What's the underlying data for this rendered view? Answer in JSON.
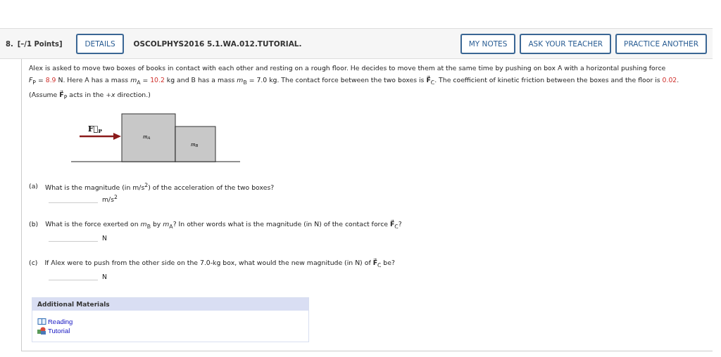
{
  "question": {
    "number": "8.",
    "points": "[–/1 Points]",
    "details_button": "DETAILS",
    "code": "OSCOLPHYS2016 5.1.WA.012.TUTORIAL.",
    "actions": [
      "MY NOTES",
      "ASK YOUR TEACHER",
      "PRACTICE ANOTHER"
    ]
  },
  "problem": {
    "lines": [
      [
        {
          "kind": "text",
          "text": "Alex is asked to move two boxes of books in contact with each other and resting on a rough floor. He decides to move them at the same time by pushing on box A with a horizontal pushing force"
        }
      ],
      [
        {
          "kind": "text",
          "text": "*F*$_{P}$ = "
        },
        {
          "kind": "value",
          "text": "8.9"
        },
        {
          "kind": "text",
          "text": " N. Here A has a mass *m*$_{A}$ = "
        },
        {
          "kind": "value",
          "text": "10.2"
        },
        {
          "kind": "text",
          "text": " kg and B has a mass *m*$_{B}$ = 7.0 kg. The contact force between the two boxes is **F⃗**$_{C}$. The coefficient of kinetic friction between the boxes and the floor is "
        },
        {
          "kind": "value",
          "text": "0.02"
        },
        {
          "kind": "text",
          "text": "."
        }
      ],
      [
        {
          "kind": "text",
          "text": "(Assume **F⃗**$_{P}$ acts in the +*x* direction.)"
        }
      ]
    ]
  },
  "diagram": {
    "force_label": {
      "symbol": "F⃗",
      "subscript": "P"
    },
    "box_a": {
      "symbol": "m",
      "subscript": "A"
    },
    "box_b": {
      "symbol": "m",
      "subscript": "B"
    }
  },
  "parts": [
    {
      "label": "(a)",
      "prompt": "What is the magnitude (in m/s$^{2}$) of the acceleration of the two boxes?",
      "unit": "m/s$^{2}$"
    },
    {
      "label": "(b)",
      "prompt": "What is the force exerted on *m*$_{B}$ by *m*$_{A}$? In other words what is the magnitude (in N) of the contact force **F⃗**$_{C}$?",
      "unit": "N"
    },
    {
      "label": "(c)",
      "prompt": "If Alex were to push from the other side on the 7.0-kg box, what would the new magnitude (in N) of **F⃗**$_{C}$ be?",
      "unit": "N"
    }
  ],
  "materials": {
    "title": "Additional Materials",
    "links": [
      {
        "label": "Reading",
        "kind": "reading"
      },
      {
        "label": "Tutorial",
        "kind": "tutorial"
      }
    ]
  }
}
